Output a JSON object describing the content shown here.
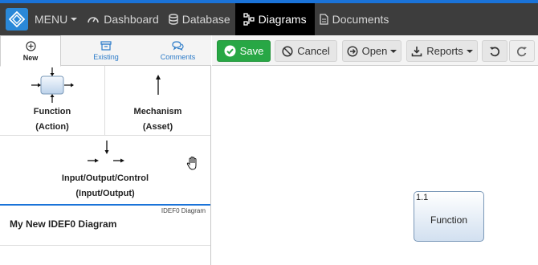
{
  "navbar": {
    "menu_label": "MENU",
    "items": [
      {
        "label": "Dashboard",
        "icon": "dashboard-icon"
      },
      {
        "label": "Database",
        "icon": "database-icon"
      },
      {
        "label": "Diagrams",
        "icon": "diagram-icon",
        "active": true
      },
      {
        "label": "Documents",
        "icon": "document-icon"
      }
    ]
  },
  "left_panel": {
    "tabs": [
      {
        "label": "New",
        "icon": "plus-circle-icon",
        "active": true
      },
      {
        "label": "Existing",
        "icon": "archive-icon"
      },
      {
        "label": "Comments",
        "icon": "comments-icon"
      }
    ],
    "shapes": [
      {
        "line1": "Function",
        "line2": "(Action)"
      },
      {
        "line1": "Mechanism",
        "line2": "(Asset)"
      },
      {
        "line1": "Input/Output/Control",
        "line2": "(Input/Output)"
      }
    ],
    "diagram": {
      "type_label": "IDEF0 Diagram",
      "name": "My New IDEF0 Diagram"
    }
  },
  "toolbar": {
    "save_label": "Save",
    "cancel_label": "Cancel",
    "open_label": "Open",
    "reports_label": "Reports"
  },
  "canvas": {
    "function_box": {
      "number": "1.1",
      "label": "Function"
    }
  },
  "colors": {
    "accent": "#1a73d9",
    "navbar": "#3d3d3d",
    "save": "#28a745"
  }
}
